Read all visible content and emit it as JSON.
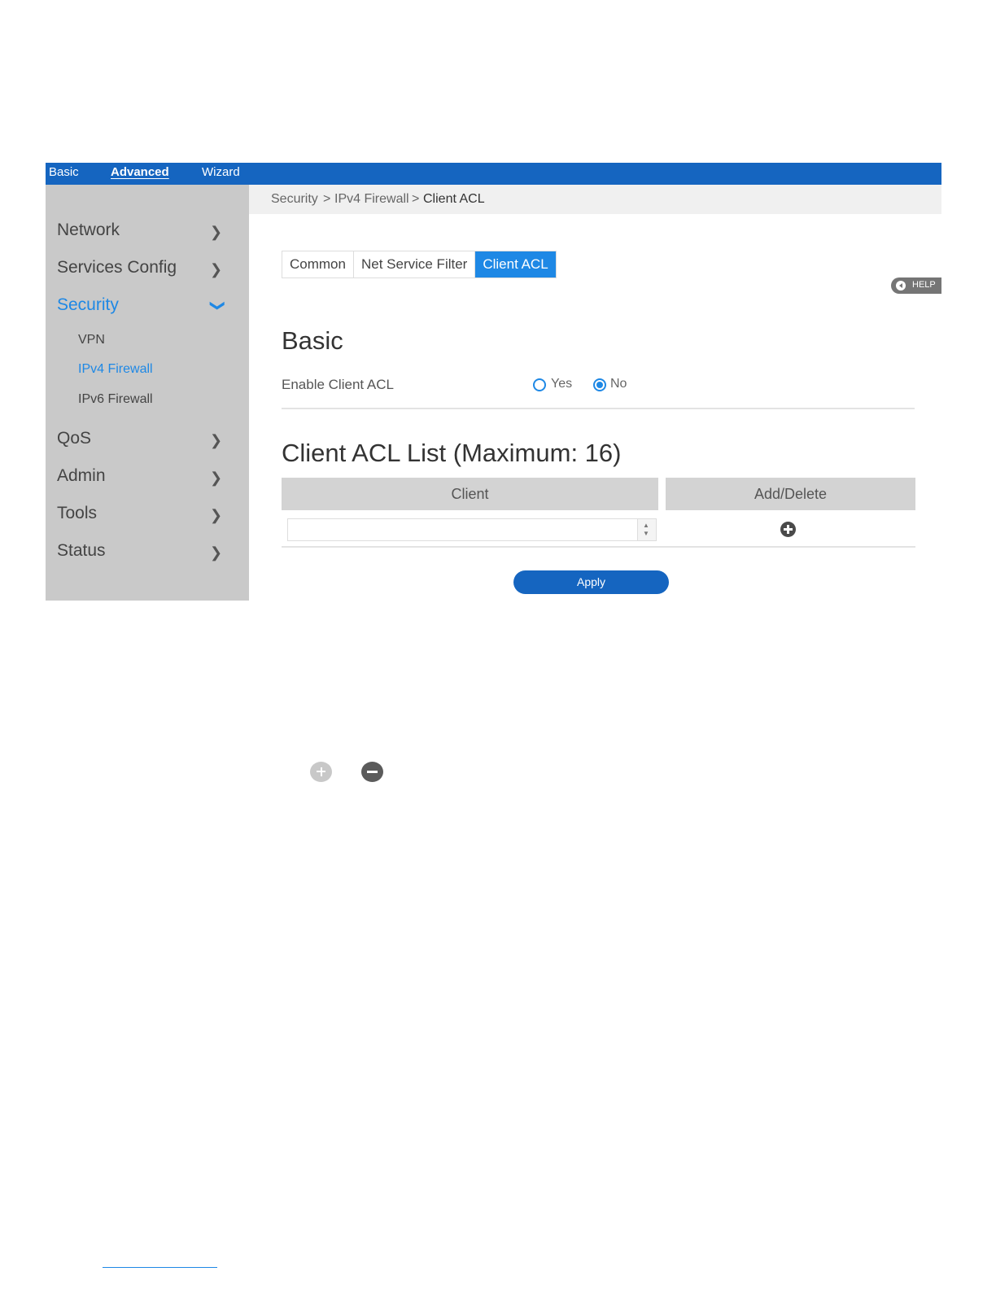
{
  "topbar": {
    "basic_label": "Basic",
    "advanced_label": "Advanced",
    "wizard_label": "Wizard"
  },
  "sidebar": {
    "items": [
      {
        "label": "Network"
      },
      {
        "label": "Services Config"
      },
      {
        "label": "Security"
      },
      {
        "label": "QoS"
      },
      {
        "label": "Admin"
      },
      {
        "label": "Tools"
      },
      {
        "label": "Status"
      }
    ],
    "security_subitems": [
      {
        "label": "VPN"
      },
      {
        "label": "IPv4 Firewall"
      },
      {
        "label": "IPv6 Firewall"
      }
    ]
  },
  "breadcrumb": {
    "part1": "Security",
    "sep": ">",
    "part2": "IPv4 Firewall",
    "current": "Client ACL"
  },
  "tabs": [
    {
      "label": "Common"
    },
    {
      "label": "Net Service Filter"
    },
    {
      "label": "Client ACL"
    }
  ],
  "help_label": "HELP",
  "basic_section": {
    "title": "Basic",
    "enable_label": "Enable Client ACL",
    "option_yes": "Yes",
    "option_no": "No",
    "selected": "No"
  },
  "acl_section": {
    "title": "Client ACL List (Maximum: 16)",
    "columns": [
      "Client",
      "Add/Delete"
    ],
    "client_value": ""
  },
  "apply_label": "Apply",
  "icons": {
    "add": "plus-circle-icon",
    "remove": "minus-circle-icon",
    "chevron": "chevron-right-icon",
    "expanded": "chevron-down-icon"
  },
  "colors": {
    "accent": "#1565c0",
    "active": "#1e88e5",
    "sidebar": "#c9c9c9"
  }
}
